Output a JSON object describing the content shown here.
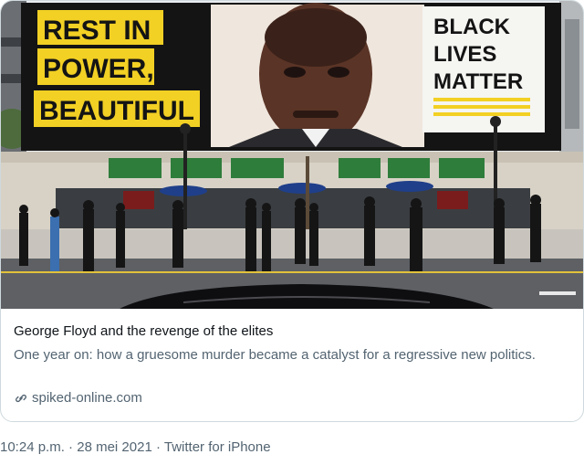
{
  "card": {
    "image": {
      "billboard_left_lines": [
        "REST IN",
        "POWER,",
        "BEAUTIFUL"
      ],
      "billboard_right_lines": [
        "BLACK",
        "LIVES",
        "MATTER"
      ],
      "colors": {
        "billboard_yellow": "#f2d024",
        "billboard_black": "#141414",
        "sky": "#e9ecef"
      }
    },
    "title": "George Floyd and the revenge of the elites",
    "description": "One year on: how a gruesome murder became a catalyst for a regressive new politics.",
    "domain": "spiked-online.com",
    "domain_icon": "link-icon"
  },
  "tweet_meta": {
    "time": "10:24 p.m.",
    "date": "28 mei 2021",
    "source": "Twitter for iPhone",
    "separator": "·"
  }
}
